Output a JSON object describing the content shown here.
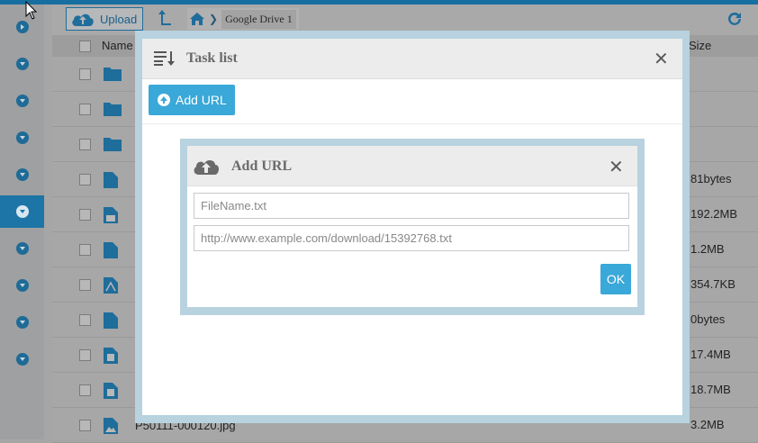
{
  "toolbar": {
    "upload_label": "Upload",
    "breadcrumb": "Google Drive 1"
  },
  "table": {
    "col_name": "Name",
    "col_size": "Size",
    "rows": [
      {
        "icon": "folder-icon",
        "name": "",
        "size": ""
      },
      {
        "icon": "folder-icon",
        "name": "",
        "size": ""
      },
      {
        "icon": "folder-icon",
        "name": "",
        "size": ""
      },
      {
        "icon": "file-icon",
        "name": "",
        "size": "81bytes"
      },
      {
        "icon": "zip-file-icon",
        "name": "",
        "size": "192.2MB"
      },
      {
        "icon": "file-icon",
        "name": "",
        "size": "1.2MB"
      },
      {
        "icon": "pdf-file-icon",
        "name": "",
        "size": "354.7KB"
      },
      {
        "icon": "file-icon",
        "name": "",
        "size": "0bytes"
      },
      {
        "icon": "media-file-icon",
        "name": "",
        "size": "17.4MB"
      },
      {
        "icon": "media-file-icon",
        "name": "",
        "size": "18.7MB"
      },
      {
        "icon": "image-file-icon",
        "name": "P50111-000120.jpg",
        "size": "3.2MB"
      }
    ]
  },
  "task_list": {
    "title": "Task list",
    "add_url_label": "Add URL"
  },
  "add_url_dialog": {
    "title": "Add URL",
    "filename_placeholder": "FileName.txt",
    "url_placeholder": "http://www.example.com/download/15392768.txt",
    "ok_label": "OK"
  },
  "colors": {
    "accent": "#3aa8d8",
    "brand_dark": "#1c75a6",
    "overlay_border": "#b8d2df"
  }
}
